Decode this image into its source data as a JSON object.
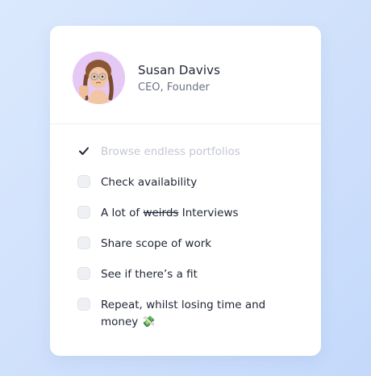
{
  "profile": {
    "name": "Susan Davivs",
    "role": "CEO, Founder"
  },
  "checklist": {
    "items": [
      {
        "text": "Browse endless portfolios",
        "checked": true
      },
      {
        "text": "Check availability",
        "checked": false
      },
      {
        "prefix": "A lot of ",
        "struck": "weirds",
        "suffix": " Interviews",
        "checked": false
      },
      {
        "text": "Share scope of work",
        "checked": false
      },
      {
        "text": "See if there’s a fit",
        "checked": false
      },
      {
        "text": "Repeat, whilst losing time and money",
        "emoji": "💸",
        "checked": false
      }
    ]
  },
  "colors": {
    "background": "#d3e3fb",
    "card": "#ffffff",
    "avatar_bg": "#e5c8f4",
    "text": "#1f2533",
    "muted_text": "#6c7384",
    "completed_text": "#c3c7d0"
  }
}
